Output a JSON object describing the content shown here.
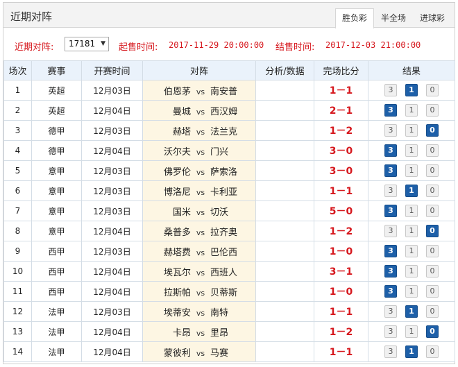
{
  "header": {
    "title": "近期对阵",
    "tabs": [
      {
        "label": "胜负彩",
        "active": true
      },
      {
        "label": "半全场",
        "active": false
      },
      {
        "label": "进球彩",
        "active": false
      }
    ]
  },
  "info": {
    "issue_label": "近期对阵:",
    "issue_value": "17181",
    "start_label": "起售时间:",
    "start_value": "2017-11-29 20:00:00",
    "end_label": "结售时间:",
    "end_value": "2017-12-03 21:00:00"
  },
  "table": {
    "columns": [
      "场次",
      "赛事",
      "开赛时间",
      "对阵",
      "分析/数据",
      "完场比分",
      "结果"
    ],
    "vs_text": "vs",
    "result_options": [
      "3",
      "1",
      "0"
    ],
    "rows": [
      {
        "no": "1",
        "league": "英超",
        "date": "12月03日",
        "home": "伯恩茅",
        "away": "南安普",
        "analysis": "",
        "score": "1－1",
        "result": "1"
      },
      {
        "no": "2",
        "league": "英超",
        "date": "12月04日",
        "home": "曼城",
        "away": "西汉姆",
        "analysis": "",
        "score": "2－1",
        "result": "3"
      },
      {
        "no": "3",
        "league": "德甲",
        "date": "12月03日",
        "home": "赫塔",
        "away": "法兰克",
        "analysis": "",
        "score": "1－2",
        "result": "0"
      },
      {
        "no": "4",
        "league": "德甲",
        "date": "12月04日",
        "home": "沃尔夫",
        "away": "门兴",
        "analysis": "",
        "score": "3－0",
        "result": "3"
      },
      {
        "no": "5",
        "league": "意甲",
        "date": "12月03日",
        "home": "佛罗伦",
        "away": "萨索洛",
        "analysis": "",
        "score": "3－0",
        "result": "3"
      },
      {
        "no": "6",
        "league": "意甲",
        "date": "12月03日",
        "home": "博洛尼",
        "away": "卡利亚",
        "analysis": "",
        "score": "1－1",
        "result": "1"
      },
      {
        "no": "7",
        "league": "意甲",
        "date": "12月03日",
        "home": "国米",
        "away": "切沃",
        "analysis": "",
        "score": "5－0",
        "result": "3"
      },
      {
        "no": "8",
        "league": "意甲",
        "date": "12月04日",
        "home": "桑普多",
        "away": "拉齐奥",
        "analysis": "",
        "score": "1－2",
        "result": "0"
      },
      {
        "no": "9",
        "league": "西甲",
        "date": "12月03日",
        "home": "赫塔费",
        "away": "巴伦西",
        "analysis": "",
        "score": "1－0",
        "result": "3"
      },
      {
        "no": "10",
        "league": "西甲",
        "date": "12月04日",
        "home": "埃瓦尔",
        "away": "西班人",
        "analysis": "",
        "score": "3－1",
        "result": "3"
      },
      {
        "no": "11",
        "league": "西甲",
        "date": "12月04日",
        "home": "拉斯帕",
        "away": "贝蒂斯",
        "analysis": "",
        "score": "1－0",
        "result": "3"
      },
      {
        "no": "12",
        "league": "法甲",
        "date": "12月03日",
        "home": "埃蒂安",
        "away": "南特",
        "analysis": "",
        "score": "1－1",
        "result": "1"
      },
      {
        "no": "13",
        "league": "法甲",
        "date": "12月04日",
        "home": "卡昂",
        "away": "里昂",
        "analysis": "",
        "score": "1－2",
        "result": "0"
      },
      {
        "no": "14",
        "league": "法甲",
        "date": "12月04日",
        "home": "蒙彼利",
        "away": "马赛",
        "analysis": "",
        "score": "1－1",
        "result": "1"
      }
    ]
  },
  "colors": {
    "accent_red": "#d6171d",
    "selected_blue": "#1d5fa8",
    "header_bg": "#eaf2fb",
    "match_bg": "#fdf6e3"
  }
}
